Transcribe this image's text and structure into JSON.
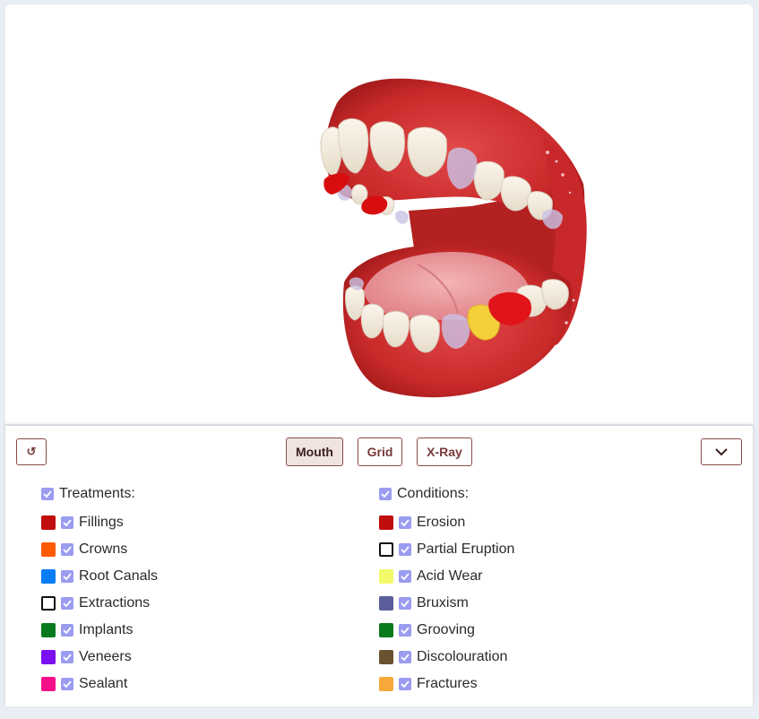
{
  "toolbar": {
    "reset_glyph": "↺",
    "views": [
      {
        "label": "Mouth",
        "active": true
      },
      {
        "label": "Grid",
        "active": false
      },
      {
        "label": "X-Ray",
        "active": false
      }
    ]
  },
  "treatments": {
    "title": "Treatments:",
    "checked": true,
    "items": [
      {
        "label": "Fillings",
        "color": "#c00d0d",
        "outline": false,
        "checked": true
      },
      {
        "label": "Crowns",
        "color": "#ff5a00",
        "outline": false,
        "checked": true
      },
      {
        "label": "Root Canals",
        "color": "#0a7df5",
        "outline": false,
        "checked": true
      },
      {
        "label": "Extractions",
        "color": "#ffffff",
        "outline": true,
        "checked": true
      },
      {
        "label": "Implants",
        "color": "#0a7a1e",
        "outline": false,
        "checked": true
      },
      {
        "label": "Veneers",
        "color": "#7a10f0",
        "outline": false,
        "checked": true
      },
      {
        "label": "Sealant",
        "color": "#f5108a",
        "outline": false,
        "checked": true
      }
    ]
  },
  "conditions": {
    "title": "Conditions:",
    "checked": true,
    "items": [
      {
        "label": "Erosion",
        "color": "#c00d0d",
        "outline": false,
        "checked": true
      },
      {
        "label": "Partial Eruption",
        "color": "#ffffff",
        "outline": true,
        "checked": true
      },
      {
        "label": "Acid Wear",
        "color": "#f2fa6a",
        "outline": false,
        "checked": true
      },
      {
        "label": "Bruxism",
        "color": "#5a5e9a",
        "outline": false,
        "checked": true
      },
      {
        "label": "Grooving",
        "color": "#0a7a1e",
        "outline": false,
        "checked": true
      },
      {
        "label": "Discolouration",
        "color": "#6a5230",
        "outline": false,
        "checked": true
      },
      {
        "label": "Fractures",
        "color": "#f7a83a",
        "outline": false,
        "checked": true
      }
    ]
  },
  "colors": {
    "accent": "#8b4a4a",
    "checkbox": "#9a9cf0"
  }
}
